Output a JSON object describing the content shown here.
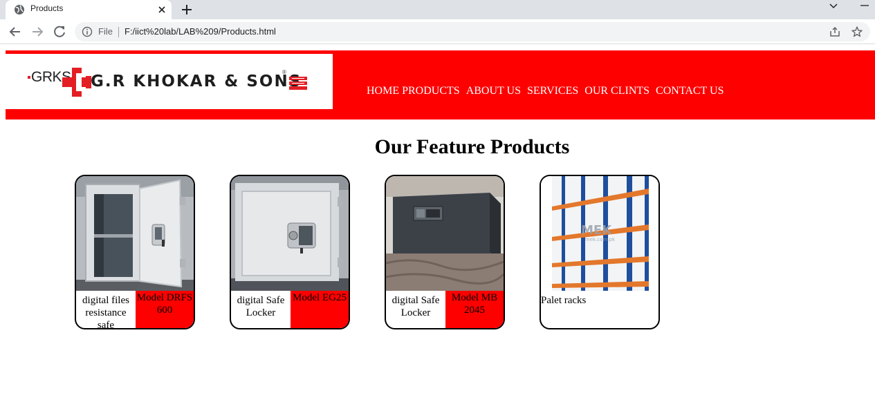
{
  "browser": {
    "tab": {
      "title": "Products",
      "favicon": "globe-icon"
    },
    "address": {
      "scheme_label": "File",
      "url": "F:/iict%20lab/LAB%209/Products.html"
    }
  },
  "header": {
    "logo": {
      "abbr": "GRKS",
      "company": "G.R KHOKAR & SONS",
      "registered": "®"
    },
    "nav": [
      {
        "label": "HOME"
      },
      {
        "label": "PRODUCTS"
      },
      {
        "label": "ABOUT US"
      },
      {
        "label": "SERVICES"
      },
      {
        "label": "OUR CLINTS"
      },
      {
        "label": "CONTACT US"
      }
    ],
    "colors": {
      "banner": "#ff0000",
      "nav_text": "#ffffff"
    }
  },
  "main": {
    "title": "Our Feature Products",
    "products": [
      {
        "name": "digital files resistance safe",
        "model": "Model DRFS 600",
        "image": "open-safe-photo"
      },
      {
        "name": "digital Safe Locker",
        "model": "Model EG25",
        "image": "closed-safe-photo"
      },
      {
        "name": "digital Safe Locker",
        "model": "Model MB 2045",
        "image": "dark-safe-photo"
      },
      {
        "name": "Palet racks",
        "model": "",
        "image": "pallet-racks-photo",
        "watermark": "MEK",
        "watermark_sub": "mek.com.pk"
      }
    ]
  }
}
